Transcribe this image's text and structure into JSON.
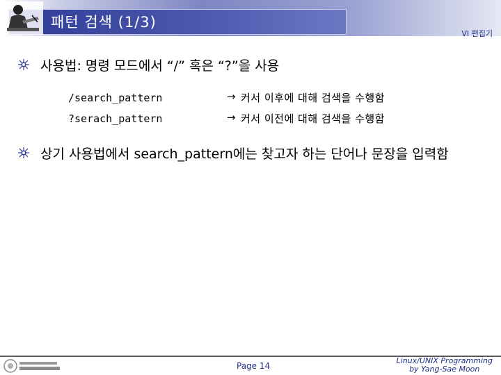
{
  "header": {
    "title": "패턴 검색 (1/3)",
    "subtitle": "VI 편집기"
  },
  "content": {
    "usage_line": "사용법: 명령 모드에서 “/” 혹은 “?”을 사용",
    "commands": [
      {
        "code": "/search_pattern",
        "arrow": "→",
        "description": "커서 이후에 대해 검색을 수행함"
      },
      {
        "code": "?serach_pattern",
        "arrow": "→",
        "description": "커서 이전에 대해 검색을 수행함"
      }
    ],
    "note_line": "상기 사용법에서 search_pattern에는 찾고자 하는 단어나 문장을 입력함"
  },
  "footer": {
    "page": "Page 14",
    "course_line1": "Linux/UNIX Programming",
    "course_line2": "by Yang-Sae Moon"
  },
  "colors": {
    "title_box": "#2f3c97",
    "accent_text": "#1f2f86"
  },
  "icons": {
    "bullet": "sunburst-bullet-icon",
    "header_logo": "person-writing-icon",
    "footer_logo": "university-seal-icon"
  }
}
